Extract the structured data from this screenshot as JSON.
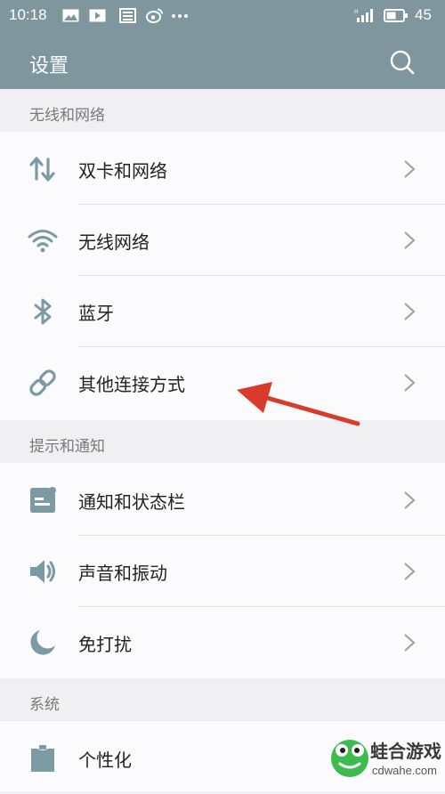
{
  "status_bar": {
    "time": "10:18",
    "battery": "45",
    "icons": [
      "image-icon",
      "video-icon",
      "news-icon",
      "weibo-icon",
      "more-dots-icon",
      "signal-icon",
      "battery-icon"
    ]
  },
  "app_bar": {
    "title": "设置",
    "search_icon": "search-icon"
  },
  "sections": [
    {
      "header": "无线和网络",
      "items": [
        {
          "label": "双卡和网络",
          "icon": "dual-sim-arrows-icon"
        },
        {
          "label": "无线网络",
          "icon": "wifi-icon"
        },
        {
          "label": "蓝牙",
          "icon": "bluetooth-icon"
        },
        {
          "label": "其他连接方式",
          "icon": "link-icon"
        }
      ]
    },
    {
      "header": "提示和通知",
      "items": [
        {
          "label": "通知和状态栏",
          "icon": "notification-icon"
        },
        {
          "label": "声音和振动",
          "icon": "speaker-icon"
        },
        {
          "label": "免打扰",
          "icon": "moon-icon"
        }
      ]
    },
    {
      "header": "系统",
      "items": [
        {
          "label": "个性化",
          "icon": "personalize-icon"
        }
      ]
    }
  ],
  "watermark": {
    "title": "蛙合游戏",
    "url": "cdwahe.com"
  },
  "colors": {
    "header_bg": "#7f969e",
    "icon": "#7b9aa3",
    "annotation_arrow": "#d83a2c"
  }
}
